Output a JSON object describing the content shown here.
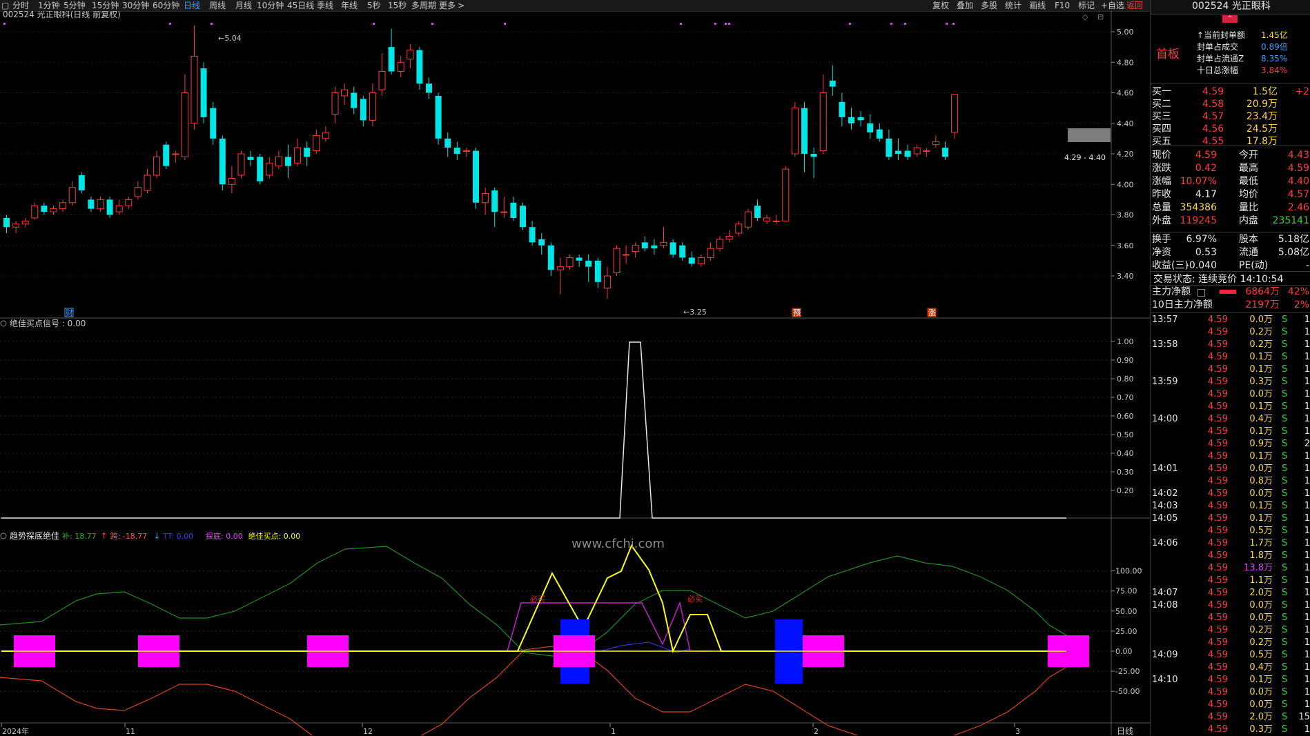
{
  "topbar": {
    "periods": [
      "分时",
      "1分钟",
      "5分钟",
      "15分钟",
      "30分钟",
      "60分钟",
      "日线",
      "周线",
      "月线",
      "10分钟",
      "45日线",
      "季线",
      "年线",
      "5秒",
      "15秒",
      "多周期",
      "更多"
    ],
    "active_period": "日线",
    "right_tools": [
      "复权",
      "叠加",
      "多股",
      "统计",
      "画线",
      "F10",
      "标记",
      "+自选",
      "返回"
    ]
  },
  "main_panel": {
    "title": "002524 光正眼科(日线 前复权)",
    "price_axis": [
      "5.00",
      "4.80",
      "4.60",
      "4.40",
      "4.20",
      "4.00",
      "3.80",
      "3.60",
      "3.40"
    ],
    "high_label": "5.04",
    "low_label": "3.25",
    "range_label": "4.29 - 4.40",
    "markers": [
      "财",
      "预",
      "涨"
    ]
  },
  "panel2": {
    "title": "绝佳买点信号 : 0.00",
    "axis": [
      "1.00",
      "0.90",
      "0.80",
      "0.70",
      "0.60",
      "0.50",
      "0.40",
      "0.30",
      "0.20"
    ]
  },
  "panel3": {
    "title": "趋势探底绝佳",
    "legend": [
      {
        "label": "补: 18.77",
        "color": "#2fae2f",
        "arrow": "↑",
        "arrow_color": "#ff3b3b"
      },
      {
        "label": "跨: -18.77",
        "color": "#ff5a2a",
        "arrow": "↓",
        "arrow_color": "#3aa0ff"
      },
      {
        "label": "TT: 0.00",
        "color": "#3a3aff"
      },
      {
        "label": "探底: 0.00",
        "color": "#e040ff"
      },
      {
        "label": "绝佳买点: 0.00",
        "color": "#ffff00"
      }
    ],
    "axis": [
      "100.00",
      "75.00",
      "50.00",
      "25.00",
      "0.00",
      "-25.00",
      "-50.00"
    ],
    "labels": [
      "必买",
      "必买"
    ],
    "watermark": "www.cfchi.com"
  },
  "x_axis": {
    "labels": [
      "2024年",
      "11",
      "12",
      "1",
      "2",
      "3"
    ],
    "mode": "日线"
  },
  "side": {
    "code_name": "002524 光正眼科",
    "board": "首板",
    "seal_info": [
      {
        "k": "↑当前封单额",
        "v": "1.45亿"
      },
      {
        "k": "封单占成交",
        "v": "0.89倍"
      },
      {
        "k": "封单占流通Z",
        "v": "8.35%"
      },
      {
        "k": "十日总涨幅",
        "v": "3.84%"
      }
    ],
    "bids": [
      {
        "label": "买一",
        "price": "4.59",
        "vol": "1.5亿",
        "chg": "+2"
      },
      {
        "label": "买二",
        "price": "4.58",
        "vol": "20.9万",
        "chg": ""
      },
      {
        "label": "买三",
        "price": "4.57",
        "vol": "23.4万",
        "chg": ""
      },
      {
        "label": "买四",
        "price": "4.56",
        "vol": "24.5万",
        "chg": ""
      },
      {
        "label": "买五",
        "price": "4.55",
        "vol": "17.8万",
        "chg": ""
      }
    ],
    "quotes": [
      {
        "k1": "现价",
        "v1": "4.59",
        "k2": "今开",
        "v2": "4.43"
      },
      {
        "k1": "涨跌",
        "v1": "0.42",
        "k2": "最高",
        "v2": "4.59"
      },
      {
        "k1": "涨幅",
        "v1": "10.07%",
        "k2": "最低",
        "v2": "4.40"
      },
      {
        "k1": "昨收",
        "v1": "4.17",
        "k2": "均价",
        "v2": "4.57"
      },
      {
        "k1": "总量",
        "v1": "354386",
        "k2": "量比",
        "v2": "2.46"
      },
      {
        "k1": "外盘",
        "v1": "119245",
        "k2": "内盘",
        "v2": "235141"
      }
    ],
    "fundamentals": [
      {
        "k1": "换手",
        "v1": "6.97%",
        "k2": "股本",
        "v2": "5.18亿"
      },
      {
        "k1": "净资",
        "v1": "0.53",
        "k2": "流通",
        "v2": "5.08亿"
      },
      {
        "k1": "收益(三)",
        "v1": "-0.040",
        "k2": "PE(动)",
        "v2": "-"
      }
    ],
    "status": "交易状态: 连续竞价 14:10:54",
    "main_flow": [
      {
        "k": "主力净额",
        "v": "6864万",
        "p": "42%"
      },
      {
        "k": "10日主力净额",
        "v": "2197万",
        "p": "2%"
      }
    ],
    "ticks": [
      {
        "t": "13:57",
        "p": "4.59",
        "v": "0.0万",
        "s": "S",
        "n": "1"
      },
      {
        "t": "",
        "p": "4.59",
        "v": "0.2万",
        "s": "S",
        "n": "1"
      },
      {
        "t": "13:58",
        "p": "4.59",
        "v": "0.2万",
        "s": "S",
        "n": "1"
      },
      {
        "t": "",
        "p": "4.59",
        "v": "0.1万",
        "s": "S",
        "n": "1"
      },
      {
        "t": "",
        "p": "4.59",
        "v": "0.1万",
        "s": "S",
        "n": "1"
      },
      {
        "t": "13:59",
        "p": "4.59",
        "v": "0.3万",
        "s": "S",
        "n": "1"
      },
      {
        "t": "",
        "p": "4.59",
        "v": "0.0万",
        "s": "S",
        "n": "1"
      },
      {
        "t": "",
        "p": "4.59",
        "v": "0.1万",
        "s": "S",
        "n": "1"
      },
      {
        "t": "14:00",
        "p": "4.59",
        "v": "0.4万",
        "s": "S",
        "n": "1"
      },
      {
        "t": "",
        "p": "4.59",
        "v": "0.1万",
        "s": "S",
        "n": "1"
      },
      {
        "t": "",
        "p": "4.59",
        "v": "0.9万",
        "s": "S",
        "n": "2"
      },
      {
        "t": "",
        "p": "4.59",
        "v": "0.1万",
        "s": "S",
        "n": "1"
      },
      {
        "t": "14:01",
        "p": "4.59",
        "v": "0.0万",
        "s": "S",
        "n": "1"
      },
      {
        "t": "",
        "p": "4.59",
        "v": "0.8万",
        "s": "S",
        "n": "1"
      },
      {
        "t": "14:02",
        "p": "4.59",
        "v": "0.0万",
        "s": "S",
        "n": "1"
      },
      {
        "t": "14:03",
        "p": "4.59",
        "v": "0.1万",
        "s": "S",
        "n": "1"
      },
      {
        "t": "14:05",
        "p": "4.59",
        "v": "0.1万",
        "s": "S",
        "n": "1"
      },
      {
        "t": "",
        "p": "4.59",
        "v": "0.5万",
        "s": "S",
        "n": "1"
      },
      {
        "t": "14:06",
        "p": "4.59",
        "v": "1.7万",
        "s": "S",
        "n": "1"
      },
      {
        "t": "",
        "p": "4.59",
        "v": "1.8万",
        "s": "S",
        "n": "1"
      },
      {
        "t": "",
        "p": "4.59",
        "v": "13.8万",
        "s": "S",
        "n": "1",
        "hl": true
      },
      {
        "t": "",
        "p": "4.59",
        "v": "1.1万",
        "s": "S",
        "n": "1"
      },
      {
        "t": "14:07",
        "p": "4.59",
        "v": "2.0万",
        "s": "S",
        "n": "1"
      },
      {
        "t": "14:08",
        "p": "4.59",
        "v": "0.0万",
        "s": "S",
        "n": "1"
      },
      {
        "t": "",
        "p": "4.59",
        "v": "0.0万",
        "s": "S",
        "n": "1"
      },
      {
        "t": "",
        "p": "4.59",
        "v": "0.2万",
        "s": "S",
        "n": "1"
      },
      {
        "t": "",
        "p": "4.59",
        "v": "0.2万",
        "s": "S",
        "n": "1"
      },
      {
        "t": "14:09",
        "p": "4.59",
        "v": "0.5万",
        "s": "S",
        "n": "1"
      },
      {
        "t": "",
        "p": "4.59",
        "v": "0.4万",
        "s": "S",
        "n": "1"
      },
      {
        "t": "14:10",
        "p": "4.59",
        "v": "0.1万",
        "s": "S",
        "n": "1"
      },
      {
        "t": "",
        "p": "4.59",
        "v": "0.0万",
        "s": "S",
        "n": "1"
      },
      {
        "t": "",
        "p": "4.59",
        "v": "0.0万",
        "s": "S",
        "n": "1"
      },
      {
        "t": "",
        "p": "4.59",
        "v": "2.0万",
        "s": "S",
        "n": "15"
      },
      {
        "t": "",
        "p": "4.59",
        "v": "0.3万",
        "s": "S",
        "n": "1"
      }
    ]
  },
  "colors": {
    "up": "#ff3b3b",
    "down": "#00e5e5",
    "ma": "#ffff00",
    "bg": "#000000"
  },
  "candles": [
    [
      3.78,
      3.72,
      3.8,
      3.68
    ],
    [
      3.72,
      3.74,
      3.76,
      3.68
    ],
    [
      3.74,
      3.76,
      3.78,
      3.72
    ],
    [
      3.78,
      3.86,
      3.88,
      3.77
    ],
    [
      3.86,
      3.82,
      3.88,
      3.8
    ],
    [
      3.82,
      3.84,
      3.86,
      3.8
    ],
    [
      3.84,
      3.88,
      3.9,
      3.82
    ],
    [
      3.88,
      3.98,
      4.02,
      3.86
    ],
    [
      4.06,
      3.96,
      4.08,
      3.94
    ],
    [
      3.9,
      3.84,
      3.92,
      3.82
    ],
    [
      3.84,
      3.9,
      3.92,
      3.82
    ],
    [
      3.9,
      3.8,
      3.92,
      3.78
    ],
    [
      3.82,
      3.86,
      3.9,
      3.8
    ],
    [
      3.86,
      3.9,
      3.92,
      3.84
    ],
    [
      3.92,
      3.98,
      4.02,
      3.9
    ],
    [
      3.96,
      4.06,
      4.1,
      3.94
    ],
    [
      4.06,
      4.18,
      4.22,
      4.04
    ],
    [
      4.26,
      4.12,
      4.28,
      4.1
    ],
    [
      4.2,
      4.2,
      4.22,
      4.14
    ],
    [
      4.18,
      4.6,
      4.72,
      4.16
    ],
    [
      4.4,
      4.84,
      5.04,
      4.36
    ],
    [
      4.76,
      4.44,
      4.8,
      4.4
    ],
    [
      4.5,
      4.3,
      4.54,
      4.26
    ],
    [
      4.3,
      4.0,
      4.32,
      3.96
    ],
    [
      4.0,
      4.04,
      4.12,
      3.94
    ],
    [
      4.06,
      4.2,
      4.22,
      4.04
    ],
    [
      4.18,
      4.16,
      4.22,
      4.12
    ],
    [
      4.18,
      4.02,
      4.2,
      4.0
    ],
    [
      4.06,
      4.14,
      4.18,
      4.04
    ],
    [
      4.12,
      4.18,
      4.22,
      4.1
    ],
    [
      4.18,
      4.12,
      4.26,
      4.04
    ],
    [
      4.14,
      4.24,
      4.3,
      4.12
    ],
    [
      4.24,
      4.18,
      4.28,
      4.12
    ],
    [
      4.22,
      4.32,
      4.36,
      4.2
    ],
    [
      4.3,
      4.34,
      4.38,
      4.28
    ],
    [
      4.46,
      4.6,
      4.64,
      4.4
    ],
    [
      4.58,
      4.62,
      4.66,
      4.52
    ],
    [
      4.6,
      4.5,
      4.64,
      4.46
    ],
    [
      4.56,
      4.42,
      4.58,
      4.38
    ],
    [
      4.42,
      4.6,
      4.66,
      4.38
    ],
    [
      4.62,
      4.74,
      4.86,
      4.58
    ],
    [
      4.9,
      4.74,
      5.02,
      4.72
    ],
    [
      4.74,
      4.8,
      4.84,
      4.7
    ],
    [
      4.82,
      4.88,
      4.92,
      4.76
    ],
    [
      4.88,
      4.66,
      4.9,
      4.62
    ],
    [
      4.66,
      4.6,
      4.7,
      4.56
    ],
    [
      4.58,
      4.3,
      4.6,
      4.26
    ],
    [
      4.3,
      4.24,
      4.34,
      4.18
    ],
    [
      4.24,
      4.2,
      4.28,
      4.16
    ],
    [
      4.22,
      4.22,
      4.24,
      4.18
    ],
    [
      4.22,
      3.88,
      4.24,
      3.84
    ],
    [
      3.88,
      3.94,
      3.98,
      3.8
    ],
    [
      3.96,
      3.82,
      3.98,
      3.72
    ],
    [
      3.82,
      3.82,
      3.92,
      3.78
    ],
    [
      3.88,
      3.78,
      3.92,
      3.76
    ],
    [
      3.86,
      3.72,
      3.88,
      3.7
    ],
    [
      3.72,
      3.62,
      3.76,
      3.6
    ],
    [
      3.64,
      3.6,
      3.68,
      3.54
    ],
    [
      3.6,
      3.44,
      3.62,
      3.4
    ],
    [
      3.44,
      3.46,
      3.52,
      3.28
    ],
    [
      3.46,
      3.52,
      3.54,
      3.44
    ],
    [
      3.52,
      3.5,
      3.54,
      3.46
    ],
    [
      3.5,
      3.46,
      3.54,
      3.36
    ],
    [
      3.5,
      3.36,
      3.52,
      3.32
    ],
    [
      3.32,
      3.4,
      3.46,
      3.25
    ],
    [
      3.42,
      3.58,
      3.6,
      3.4
    ],
    [
      3.54,
      3.54,
      3.6,
      3.48
    ],
    [
      3.56,
      3.6,
      3.62,
      3.52
    ],
    [
      3.62,
      3.58,
      3.66,
      3.56
    ],
    [
      3.6,
      3.58,
      3.64,
      3.54
    ],
    [
      3.6,
      3.62,
      3.72,
      3.58
    ],
    [
      3.62,
      3.54,
      3.64,
      3.52
    ],
    [
      3.6,
      3.52,
      3.62,
      3.5
    ],
    [
      3.52,
      3.48,
      3.56,
      3.46
    ],
    [
      3.48,
      3.52,
      3.54,
      3.46
    ],
    [
      3.52,
      3.58,
      3.62,
      3.5
    ],
    [
      3.58,
      3.64,
      3.66,
      3.56
    ],
    [
      3.64,
      3.66,
      3.7,
      3.62
    ],
    [
      3.68,
      3.74,
      3.76,
      3.66
    ],
    [
      3.72,
      3.82,
      3.84,
      3.7
    ],
    [
      3.86,
      3.78,
      3.9,
      3.76
    ],
    [
      3.76,
      3.78,
      3.8,
      3.74
    ],
    [
      3.76,
      3.76,
      3.8,
      3.74
    ],
    [
      3.76,
      4.1,
      4.12,
      3.76
    ],
    [
      4.2,
      4.5,
      4.54,
      4.18
    ],
    [
      4.5,
      4.2,
      4.54,
      4.08
    ],
    [
      4.2,
      4.18,
      4.24,
      4.04
    ],
    [
      4.22,
      4.6,
      4.72,
      4.2
    ],
    [
      4.68,
      4.64,
      4.78,
      4.58
    ],
    [
      4.54,
      4.44,
      4.6,
      4.38
    ],
    [
      4.44,
      4.4,
      4.5,
      4.36
    ],
    [
      4.44,
      4.42,
      4.48,
      4.38
    ],
    [
      4.4,
      4.34,
      4.46,
      4.3
    ],
    [
      4.36,
      4.3,
      4.4,
      4.28
    ],
    [
      4.3,
      4.18,
      4.36,
      4.16
    ],
    [
      4.22,
      4.2,
      4.3,
      4.16
    ],
    [
      4.22,
      4.18,
      4.26,
      4.16
    ],
    [
      4.2,
      4.24,
      4.26,
      4.18
    ],
    [
      4.22,
      4.22,
      4.24,
      4.18
    ],
    [
      4.26,
      4.28,
      4.32,
      4.24
    ],
    [
      4.24,
      4.18,
      4.28,
      4.16
    ],
    [
      4.34,
      4.59,
      4.59,
      4.3
    ]
  ]
}
